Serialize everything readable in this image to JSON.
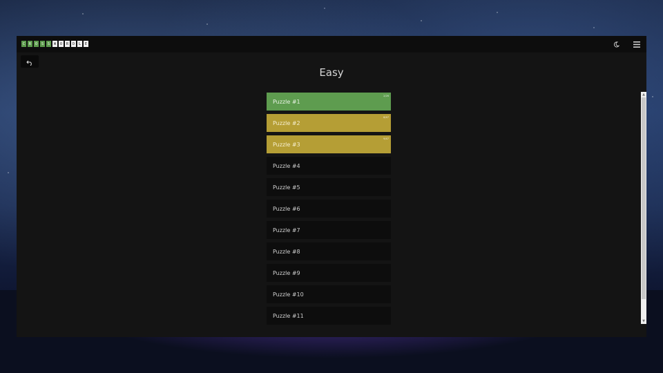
{
  "app": {
    "logo_letters": [
      {
        "ch": "C",
        "style": "g"
      },
      {
        "ch": "R",
        "style": "g"
      },
      {
        "ch": "O",
        "style": "g"
      },
      {
        "ch": "S",
        "style": "g"
      },
      {
        "ch": "S",
        "style": "g"
      },
      {
        "ch": "W",
        "style": "w"
      },
      {
        "ch": "O",
        "style": "w"
      },
      {
        "ch": "R",
        "style": "w"
      },
      {
        "ch": "D",
        "style": "w"
      },
      {
        "ch": "L",
        "style": "w"
      },
      {
        "ch": "E",
        "style": "w"
      }
    ]
  },
  "header": {
    "theme_icon": "moon-icon",
    "menu_icon": "hamburger-menu-icon"
  },
  "page": {
    "title": "Easy"
  },
  "puzzles": [
    {
      "label": "Puzzle #1",
      "status": "green",
      "score": "2/26"
    },
    {
      "label": "Puzzle #2",
      "status": "yellow",
      "score": "8/47"
    },
    {
      "label": "Puzzle #3",
      "status": "yellow",
      "score": "9/47"
    },
    {
      "label": "Puzzle #4",
      "status": "none",
      "score": ""
    },
    {
      "label": "Puzzle #5",
      "status": "none",
      "score": ""
    },
    {
      "label": "Puzzle #6",
      "status": "none",
      "score": ""
    },
    {
      "label": "Puzzle #7",
      "status": "none",
      "score": ""
    },
    {
      "label": "Puzzle #8",
      "status": "none",
      "score": ""
    },
    {
      "label": "Puzzle #9",
      "status": "none",
      "score": ""
    },
    {
      "label": "Puzzle #10",
      "status": "none",
      "score": ""
    },
    {
      "label": "Puzzle #11",
      "status": "none",
      "score": ""
    }
  ],
  "colors": {
    "solved": "#5e9c4f",
    "in_progress": "#b59e35",
    "unsolved": "#0d0d0d"
  }
}
